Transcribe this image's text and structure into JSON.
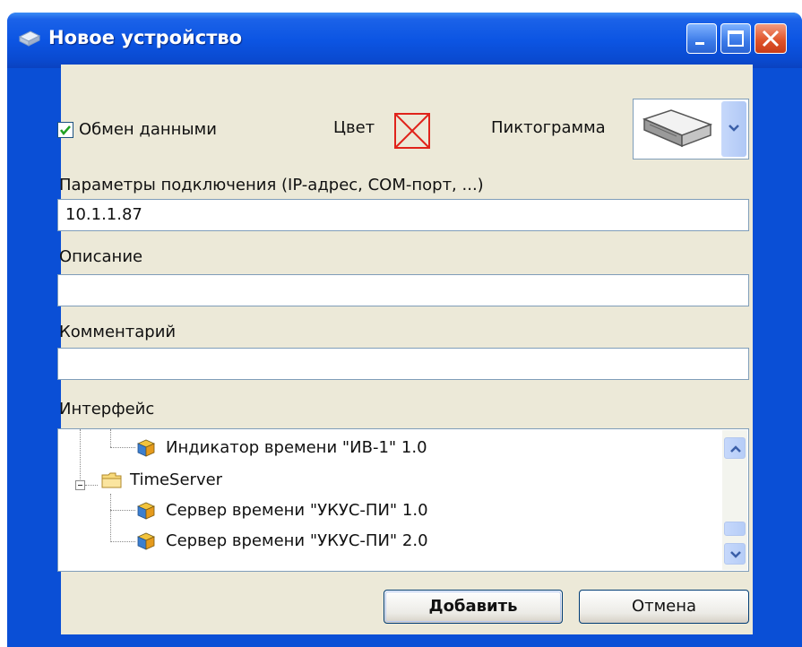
{
  "window": {
    "title": "Новое устройство",
    "icons": {
      "app": "device-icon",
      "minimize": "minimize-icon",
      "maximize": "maximize-icon",
      "close": "close-icon"
    }
  },
  "top_row": {
    "data_exchange": {
      "label": "Обмен данными",
      "checked": true
    },
    "color": {
      "label": "Цвет",
      "value_icon": "red-x-icon",
      "color": "#e0231b"
    },
    "pictogram": {
      "label": "Пиктограмма",
      "value_icon": "network-device-icon"
    }
  },
  "connection": {
    "label": "Параметры подключения (IP-адрес, COM-порт, ...)",
    "value": "10.1.1.87"
  },
  "description": {
    "label": "Описание",
    "value": ""
  },
  "comment": {
    "label": "Комментарий",
    "value": ""
  },
  "interface": {
    "label": "Интерфейс",
    "items": [
      {
        "text": "Индикатор времени \"ИВ-1\" 1.0",
        "icon": "cube-icon",
        "level": 1
      },
      {
        "text": "TimeServer",
        "icon": "folder-icon",
        "level": 0,
        "expanded": true
      },
      {
        "text": "Сервер времени \"УКУС-ПИ\" 1.0",
        "icon": "cube-icon",
        "level": 1
      },
      {
        "text": "Сервер времени \"УКУС-ПИ\" 2.0",
        "icon": "cube-icon",
        "level": 1
      }
    ]
  },
  "buttons": {
    "add": "Добавить",
    "cancel": "Отмена"
  },
  "colors": {
    "titlebar": "#0c55e3",
    "client": "#ece9d8",
    "close": "#e0552c"
  }
}
